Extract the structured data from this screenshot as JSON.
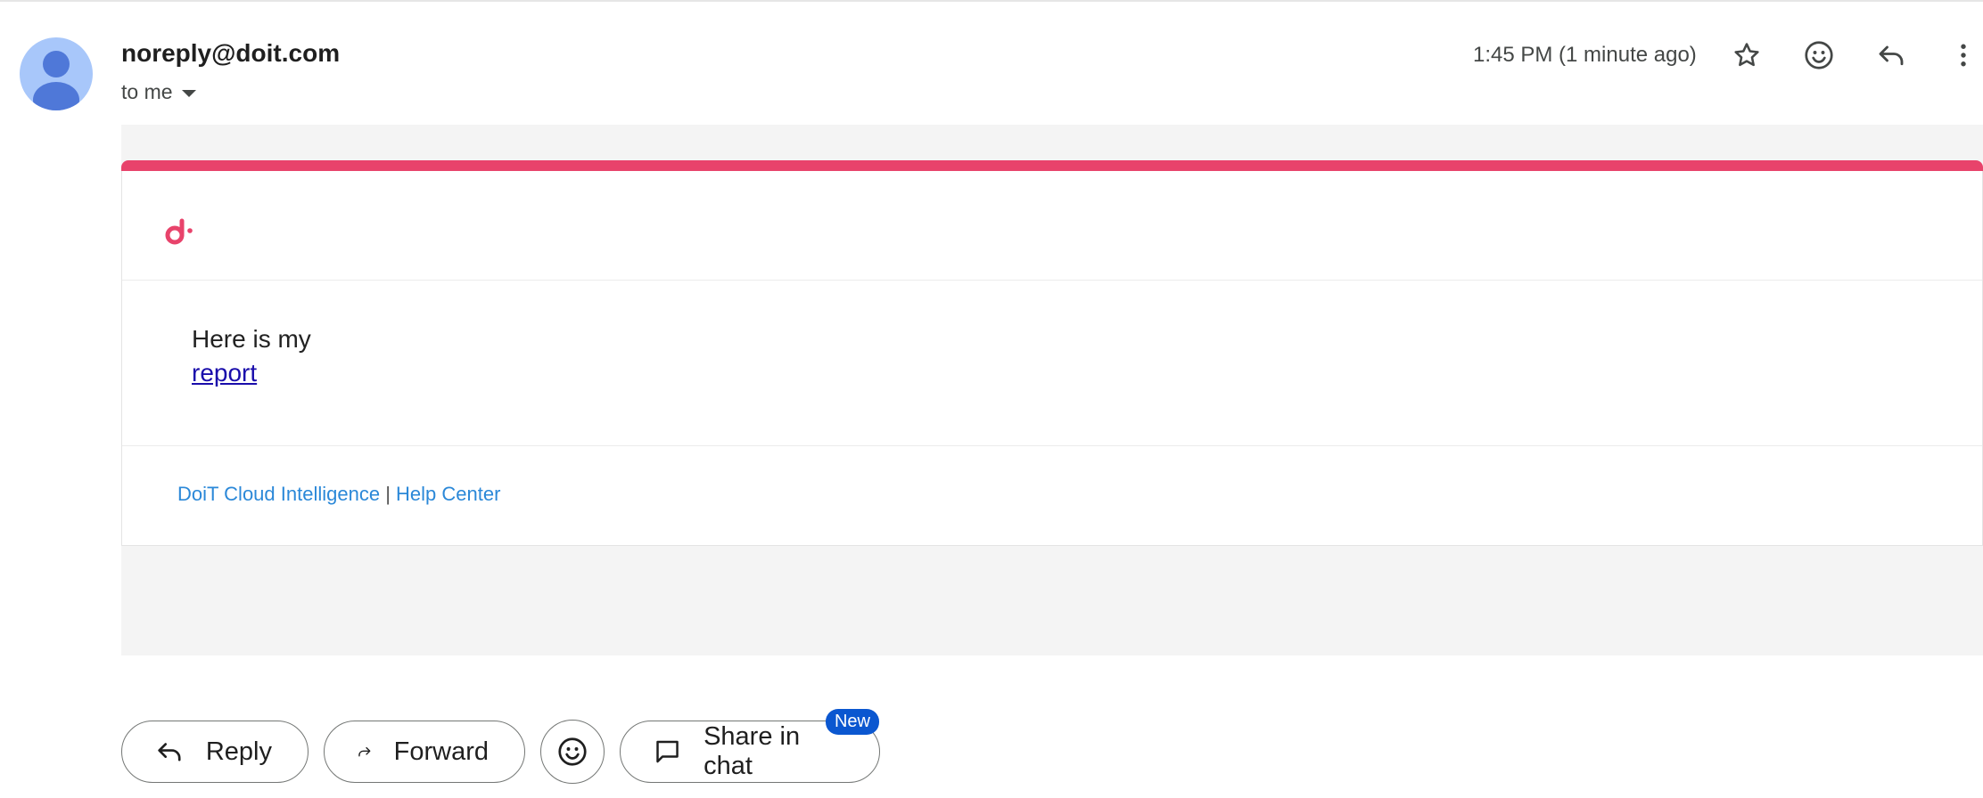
{
  "header": {
    "sender": "noreply@doit.com",
    "recipients": "to me",
    "timestamp": "1:45 PM (1 minute ago)",
    "icons": [
      "star-icon",
      "emoji-icon",
      "reply-icon",
      "more-vert-icon"
    ]
  },
  "email": {
    "brand_color": "#e8436b",
    "body_line1": "Here is my",
    "body_link": "report",
    "footer_link1": "DoiT Cloud Intelligence",
    "footer_separator": "|",
    "footer_link2": "Help Center"
  },
  "actions": {
    "reply_label": "Reply",
    "forward_label": "Forward",
    "share_label": "Share in chat",
    "new_badge": "New"
  }
}
